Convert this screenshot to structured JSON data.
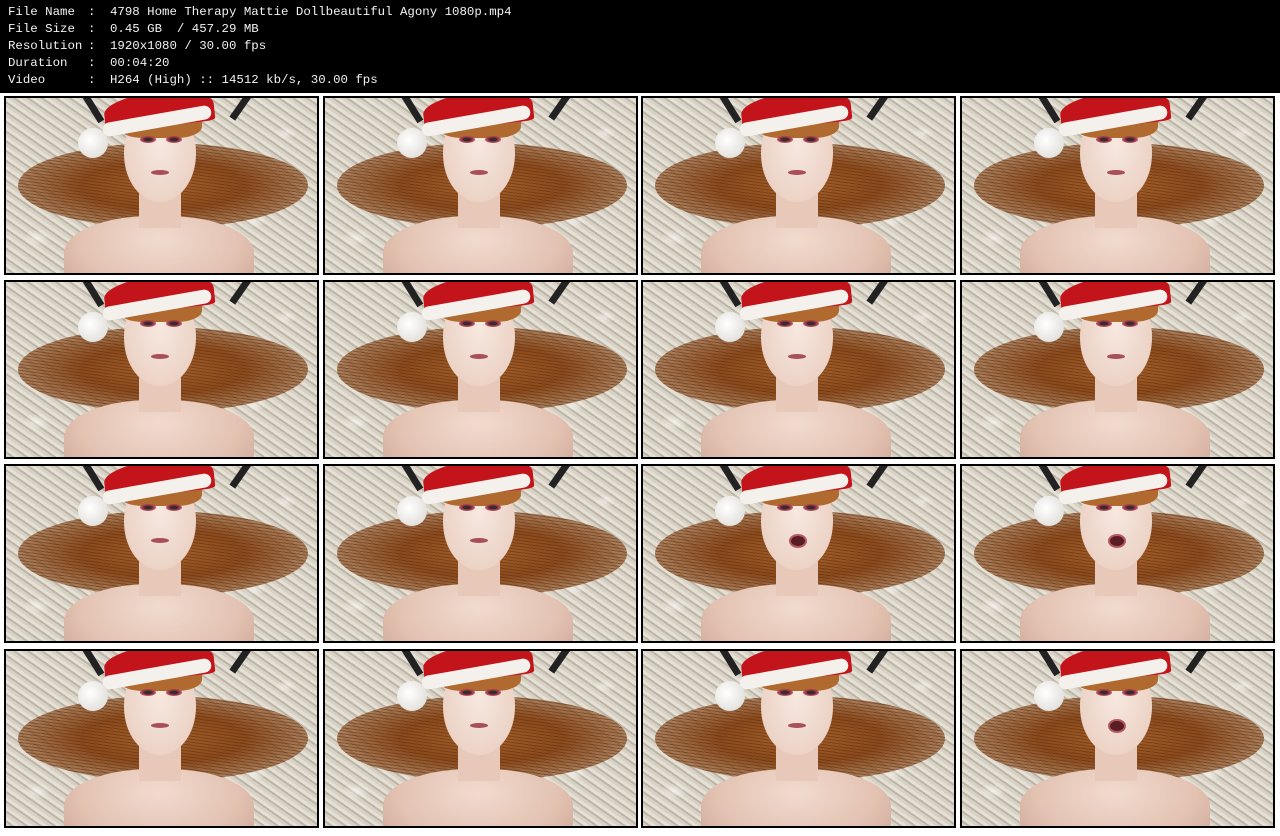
{
  "info": {
    "rows": [
      {
        "label": "File Name",
        "sep": ":",
        "value": "4798 Home Therapy Mattie Dollbeautiful Agony 1080p.mp4"
      },
      {
        "label": "File Size",
        "sep": ":",
        "value": "0.45 GB  / 457.29 MB"
      },
      {
        "label": "Resolution",
        "sep": ":",
        "value": "1920x1080 / 30.00 fps"
      },
      {
        "label": "Duration",
        "sep": ":",
        "value": "00:04:20"
      },
      {
        "label": "Video",
        "sep": ":",
        "value": "H264 (High) :: 14512 kb/s, 30.00 fps"
      }
    ]
  },
  "thumbnails": {
    "rows": 4,
    "columns": 4,
    "mouth_open": [
      false,
      false,
      false,
      false,
      false,
      false,
      false,
      false,
      false,
      false,
      true,
      true,
      false,
      false,
      false,
      true
    ]
  },
  "colors": {
    "header_bg": "#000000",
    "header_text": "#f2f2f2",
    "grid_bg": "#ffffff",
    "frame_border": "#000000"
  }
}
